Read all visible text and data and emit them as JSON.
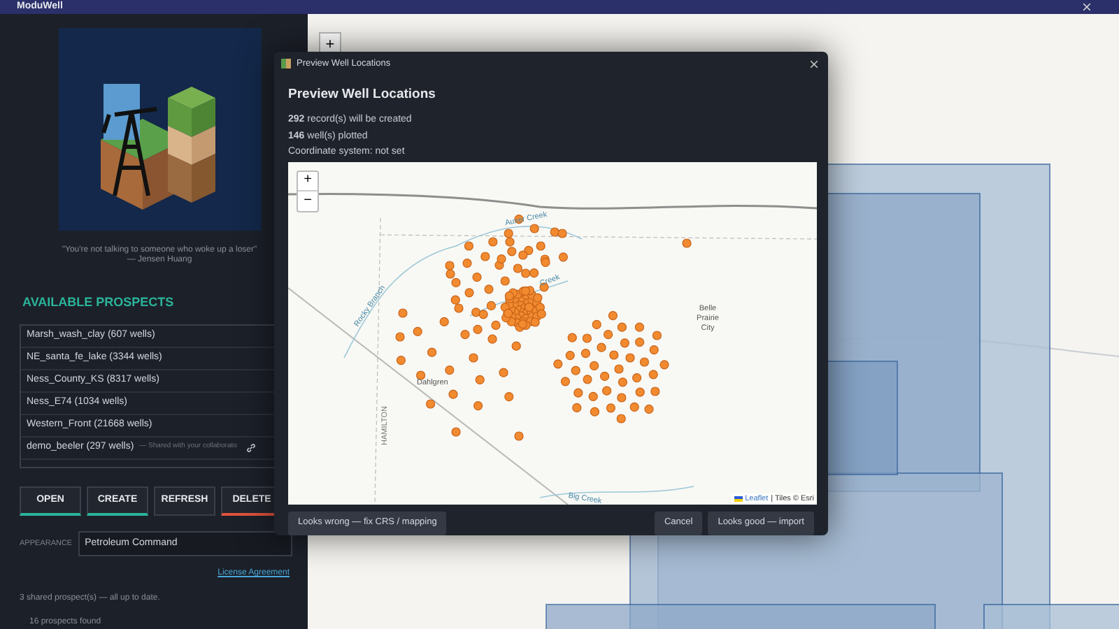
{
  "window": {
    "title": "ModuWell"
  },
  "sidebar": {
    "quote": "\"You're not talking to someone who woke up a loser\"",
    "author": "— Jensen Huang",
    "section_title": "AVAILABLE PROSPECTS",
    "prospects": [
      {
        "name": "Marsh_wash_clay (607 wells)"
      },
      {
        "name": "NE_santa_fe_lake (3344 wells)"
      },
      {
        "name": "Ness_County_KS (8317 wells)"
      },
      {
        "name": "Ness_E74 (1034 wells)"
      },
      {
        "name": "Western_Front (21668 wells)"
      },
      {
        "name": "demo_beeler (297 wells)",
        "note": "— Shared with your collaborato",
        "shared": true
      }
    ],
    "buttons": [
      {
        "label": "OPEN",
        "kind": "primary"
      },
      {
        "label": "CREATE",
        "kind": "primary"
      },
      {
        "label": "REFRESH",
        "kind": "plain"
      },
      {
        "label": "DELETE",
        "kind": "danger"
      }
    ],
    "appearance": {
      "label": "APPEARANCE",
      "value": "Petroleum Command"
    },
    "license_link": "License Agreement",
    "shared_status": "3 shared prospect(s) — all up to date.",
    "found_count": "16 prospects found"
  },
  "map": {
    "zoom_in": "+"
  },
  "dialog": {
    "title": "Preview Well Locations",
    "heading": "Preview Well Locations",
    "lines": [
      "**292** record(s) will be created",
      "**146** well(s) plotted",
      "Coordinate system: not set"
    ],
    "map": {
      "zoom_in": "+",
      "zoom_out": "−",
      "labels": [
        {
          "text": "Auxer Creek",
          "kind": "water"
        },
        {
          "text": "Creek",
          "kind": "water"
        },
        {
          "text": "Rocky Branch",
          "kind": "water"
        },
        {
          "text": "Belle Prairie City",
          "kind": "place"
        },
        {
          "text": "Dahlgren",
          "kind": "place"
        },
        {
          "text": "HAMILTON",
          "kind": "township"
        },
        {
          "text": "Big Creek",
          "kind": "water"
        }
      ],
      "attribution_link": "Leaflet",
      "attribution_text": "| Tiles © Esri"
    },
    "buttons": [
      {
        "label": "Looks wrong — fix CRS / mapping",
        "kind": "secondary"
      },
      {
        "label": "Cancel",
        "kind": "secondary"
      },
      {
        "label": "Looks good — import",
        "kind": "secondary"
      }
    ]
  }
}
